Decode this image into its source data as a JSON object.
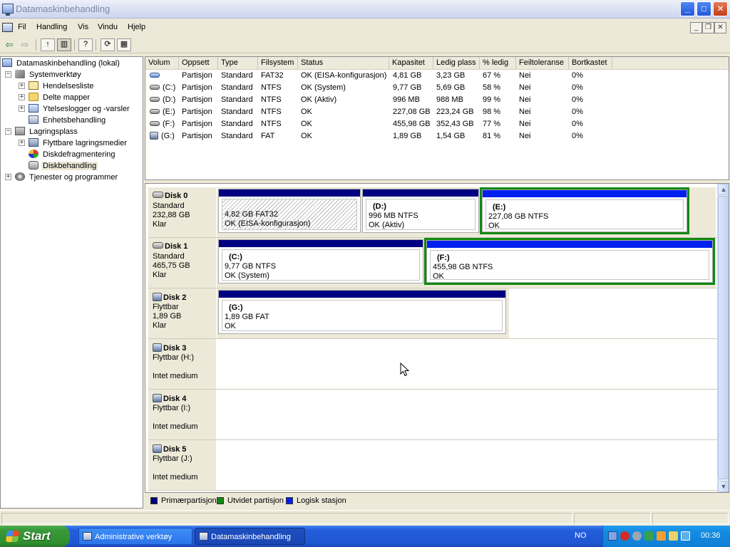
{
  "window": {
    "title": "Datamaskinbehandling",
    "minimize": "_",
    "maximize": "□",
    "close": "✕"
  },
  "menu": {
    "items": [
      "Fil",
      "Handling",
      "Vis",
      "Vindu",
      "Hjelp"
    ]
  },
  "toolbar": {
    "back": "⇦",
    "forward": "⇨"
  },
  "tree": {
    "root": "Datamaskinbehandling (lokal)",
    "systemtools": "Systemverktøy",
    "eventviewer": "Hendelsesliste",
    "sharedfolders": "Delte mapper",
    "perflogs": "Ytelseslogger og -varsler",
    "devicemanager": "Enhetsbehandling",
    "storage": "Lagringsplass",
    "removable": "Flyttbare lagringsmedier",
    "defrag": "Diskdefragmentering",
    "diskmgmt": "Diskbehandling",
    "services": "Tjenester og programmer"
  },
  "volumes": {
    "columns": [
      "Volum",
      "Oppsett",
      "Type",
      "Filsystem",
      "Status",
      "Kapasitet",
      "Ledig plass",
      "% ledig",
      "Feiltoleranse",
      "Bortkastet"
    ],
    "rows": [
      {
        "volum": "",
        "oppsett": "Partisjon",
        "type": "Standard",
        "fs": "FAT32",
        "status": "OK (EISA-konfigurasjon)",
        "kap": "4,81 GB",
        "ledig": "3,23 GB",
        "pct": "67 %",
        "feil": "Nei",
        "bort": "0%"
      },
      {
        "volum": "(C:)",
        "oppsett": "Partisjon",
        "type": "Standard",
        "fs": "NTFS",
        "status": "OK (System)",
        "kap": "9,77 GB",
        "ledig": "5,69 GB",
        "pct": "58 %",
        "feil": "Nei",
        "bort": "0%"
      },
      {
        "volum": "(D:)",
        "oppsett": "Partisjon",
        "type": "Standard",
        "fs": "NTFS",
        "status": "OK (Aktiv)",
        "kap": "996 MB",
        "ledig": "988 MB",
        "pct": "99 %",
        "feil": "Nei",
        "bort": "0%"
      },
      {
        "volum": "(E:)",
        "oppsett": "Partisjon",
        "type": "Standard",
        "fs": "NTFS",
        "status": "OK",
        "kap": "227,08 GB",
        "ledig": "223,24 GB",
        "pct": "98 %",
        "feil": "Nei",
        "bort": "0%"
      },
      {
        "volum": "(F:)",
        "oppsett": "Partisjon",
        "type": "Standard",
        "fs": "NTFS",
        "status": "OK",
        "kap": "455,98 GB",
        "ledig": "352,43 GB",
        "pct": "77 %",
        "feil": "Nei",
        "bort": "0%"
      },
      {
        "volum": "(G:)",
        "oppsett": "Partisjon",
        "type": "Standard",
        "fs": "FAT",
        "status": "OK",
        "kap": "1,89 GB",
        "ledig": "1,54 GB",
        "pct": "81 %",
        "feil": "Nei",
        "bort": "0%"
      }
    ]
  },
  "disks": [
    {
      "name": "Disk 0",
      "type": "Standard",
      "size": "232,88 GB",
      "status": "Klar",
      "parts": [
        {
          "letter": "",
          "desc": "4,82 GB FAT32",
          "status": "OK (EISA-konfigurasjon)"
        },
        {
          "letter": "(D:)",
          "desc": "996 MB NTFS",
          "status": "OK (Aktiv)"
        },
        {
          "letter": "(E:)",
          "desc": "227,08 GB NTFS",
          "status": "OK"
        }
      ]
    },
    {
      "name": "Disk 1",
      "type": "Standard",
      "size": "465,75 GB",
      "status": "Klar",
      "parts": [
        {
          "letter": "(C:)",
          "desc": "9,77 GB NTFS",
          "status": "OK (System)"
        },
        {
          "letter": "(F:)",
          "desc": "455,98 GB NTFS",
          "status": "OK"
        }
      ]
    },
    {
      "name": "Disk 2",
      "type": "Flyttbar",
      "size": "1,89 GB",
      "status": "Klar",
      "parts": [
        {
          "letter": "(G:)",
          "desc": "1,89 GB FAT",
          "status": "OK"
        }
      ]
    },
    {
      "name": "Disk 3",
      "type": "Flyttbar (H:)",
      "status": "Intet medium"
    },
    {
      "name": "Disk 4",
      "type": "Flyttbar (I:)",
      "status": "Intet medium"
    },
    {
      "name": "Disk 5",
      "type": "Flyttbar (J:)",
      "status": "Intet medium"
    }
  ],
  "legend": {
    "items": [
      {
        "label": "Primærpartisjon",
        "color": "#000080"
      },
      {
        "label": "Utvidet partisjon",
        "color": "#118811"
      },
      {
        "label": "Logisk stasjon",
        "color": "#0020f0"
      }
    ]
  },
  "taskbar": {
    "start": "Start",
    "tasks": [
      "Administrative verktøy",
      "Datamaskinbehandling"
    ],
    "language": "NO",
    "clock": "00:36"
  },
  "colors": {
    "primary": "#000080",
    "extended": "#118811",
    "logical": "#0020f0",
    "taskbar": "#245edb",
    "start": "#3a9a3a"
  }
}
